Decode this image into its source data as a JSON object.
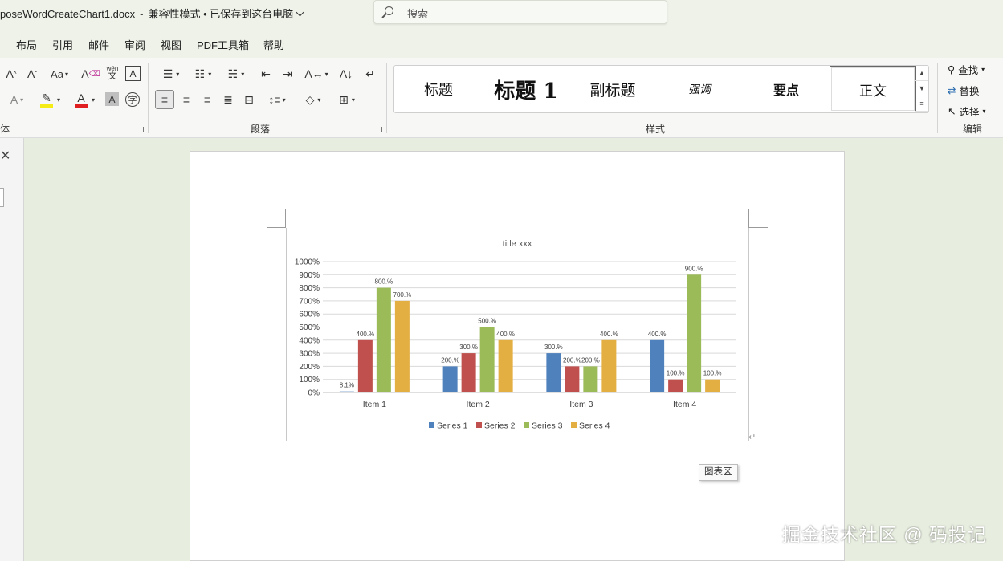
{
  "titlebar": {
    "doc_name": "poseWordCreateChart1.docx",
    "mode": "兼容性模式 • 已保存到这台电脑"
  },
  "search": {
    "placeholder": "搜索"
  },
  "tabs": [
    "布局",
    "引用",
    "邮件",
    "审阅",
    "视图",
    "PDF工具箱",
    "帮助"
  ],
  "ribbon": {
    "font_group_label": "体",
    "paragraph_group_label": "段落",
    "styles_group_label": "样式",
    "editing_group_label": "编辑",
    "phonetic_top": "wén",
    "phonetic_bottom": "文",
    "styles": [
      "标题",
      "标题 1",
      "副标题",
      "强调",
      "要点",
      "正文"
    ],
    "editing": {
      "find": "查找",
      "replace": "替换",
      "select": "选择"
    }
  },
  "chart_tooltip": "图表区",
  "watermark": "掘金技术社区 @ 码投记",
  "colors": {
    "series1": "#4f81bd",
    "series2": "#c0504d",
    "series3": "#9bbb59",
    "series4": "#e4af42",
    "accent_font_red": "#e02020",
    "highlight_yellow": "#f5ec15"
  },
  "chart_data": {
    "type": "bar",
    "title": "title xxx",
    "categories": [
      "Item 1",
      "Item 2",
      "Item 3",
      "Item 4"
    ],
    "series": [
      {
        "name": "Series 1",
        "values": [
          8.1,
          200,
          300,
          400
        ],
        "labels": [
          "8.1%",
          "200.%",
          "300.%",
          "400.%"
        ]
      },
      {
        "name": "Series 2",
        "values": [
          400,
          300,
          200,
          100
        ],
        "labels": [
          "400.%",
          "300.%",
          "200.%",
          "100.%"
        ]
      },
      {
        "name": "Series 3",
        "values": [
          800,
          500,
          200,
          900
        ],
        "labels": [
          "800.%",
          "500.%",
          "200.%",
          "900.%"
        ]
      },
      {
        "name": "Series 4",
        "values": [
          700,
          400,
          400,
          100
        ],
        "labels": [
          "700.%",
          "400.%",
          "400.%",
          "100.%"
        ]
      }
    ],
    "ylim": [
      0,
      1000
    ],
    "yticks": [
      "0%",
      "100%",
      "200%",
      "300%",
      "400%",
      "500%",
      "600%",
      "700%",
      "800%",
      "900%",
      "1000%"
    ],
    "grid": true,
    "legend": "bottom"
  }
}
